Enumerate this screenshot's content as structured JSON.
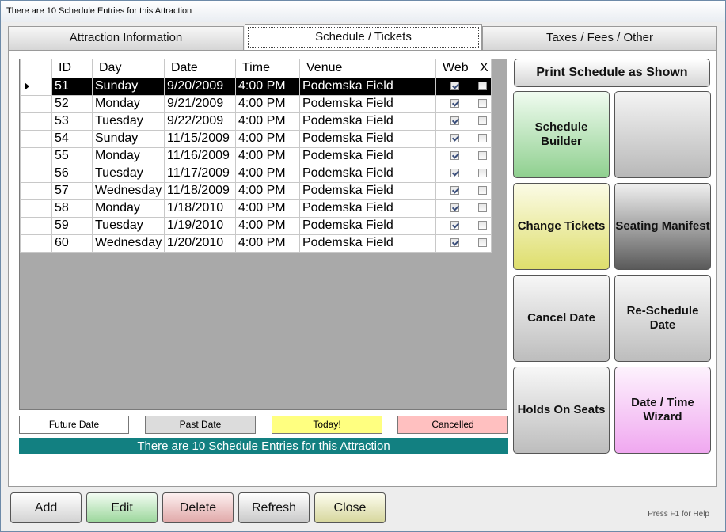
{
  "window": {
    "title": "There are 10 Schedule Entries for this Attraction"
  },
  "tabs": [
    {
      "label": "Attraction Information"
    },
    {
      "label": "Schedule / Tickets"
    },
    {
      "label": "Taxes / Fees / Other"
    }
  ],
  "grid": {
    "columns": {
      "id": "ID",
      "day": "Day",
      "date": "Date",
      "time": "Time",
      "venue": "Venue",
      "web": "Web",
      "x": "X"
    },
    "rows": [
      {
        "id": "51",
        "day": "Sunday",
        "date": "9/20/2009",
        "time": "4:00 PM",
        "venue": "Podemska Field",
        "web": true,
        "x": false
      },
      {
        "id": "52",
        "day": "Monday",
        "date": "9/21/2009",
        "time": "4:00 PM",
        "venue": "Podemska Field",
        "web": true,
        "x": false
      },
      {
        "id": "53",
        "day": "Tuesday",
        "date": "9/22/2009",
        "time": "4:00 PM",
        "venue": "Podemska Field",
        "web": true,
        "x": false
      },
      {
        "id": "54",
        "day": "Sunday",
        "date": "11/15/2009",
        "time": "4:00 PM",
        "venue": "Podemska Field",
        "web": true,
        "x": false
      },
      {
        "id": "55",
        "day": "Monday",
        "date": "11/16/2009",
        "time": "4:00 PM",
        "venue": "Podemska Field",
        "web": true,
        "x": false
      },
      {
        "id": "56",
        "day": "Tuesday",
        "date": "11/17/2009",
        "time": "4:00 PM",
        "venue": "Podemska Field",
        "web": true,
        "x": false
      },
      {
        "id": "57",
        "day": "Wednesday",
        "date": "11/18/2009",
        "time": "4:00 PM",
        "venue": "Podemska Field",
        "web": true,
        "x": false
      },
      {
        "id": "58",
        "day": "Monday",
        "date": "1/18/2010",
        "time": "4:00 PM",
        "venue": "Podemska Field",
        "web": true,
        "x": false
      },
      {
        "id": "59",
        "day": "Tuesday",
        "date": "1/19/2010",
        "time": "4:00 PM",
        "venue": "Podemska Field",
        "web": true,
        "x": false
      },
      {
        "id": "60",
        "day": "Wednesday",
        "date": "1/20/2010",
        "time": "4:00 PM",
        "venue": "Podemska Field",
        "web": true,
        "x": false
      }
    ],
    "selected_row_id": "51"
  },
  "legend": {
    "future": {
      "label": "Future Date",
      "color": "#ffffff"
    },
    "past": {
      "label": "Past Date",
      "color": "#dcdcdc"
    },
    "today": {
      "label": "Today!",
      "color": "#ffff80"
    },
    "cancelled": {
      "label": "Cancelled",
      "color": "#ffc0c0"
    }
  },
  "status": {
    "text": "There are 10 Schedule Entries for this Attraction",
    "color": "#128081"
  },
  "actions": {
    "print_schedule": "Print Schedule as Shown",
    "schedule_builder": "Schedule Builder",
    "blank": "",
    "change_tickets": "Change Tickets",
    "seating_manifest": "Seating Manifest",
    "cancel_date": "Cancel Date",
    "reschedule_date": "Re-Schedule Date",
    "holds_on_seats": "Holds On Seats",
    "date_time_wizard": "Date / Time Wizard"
  },
  "bottom": {
    "add": "Add",
    "edit": "Edit",
    "delete": "Delete",
    "refresh": "Refresh",
    "close": "Close",
    "help": "Press F1 for Help"
  },
  "icons": {
    "row_pointer": "row-pointer-icon",
    "check": "check-icon"
  }
}
